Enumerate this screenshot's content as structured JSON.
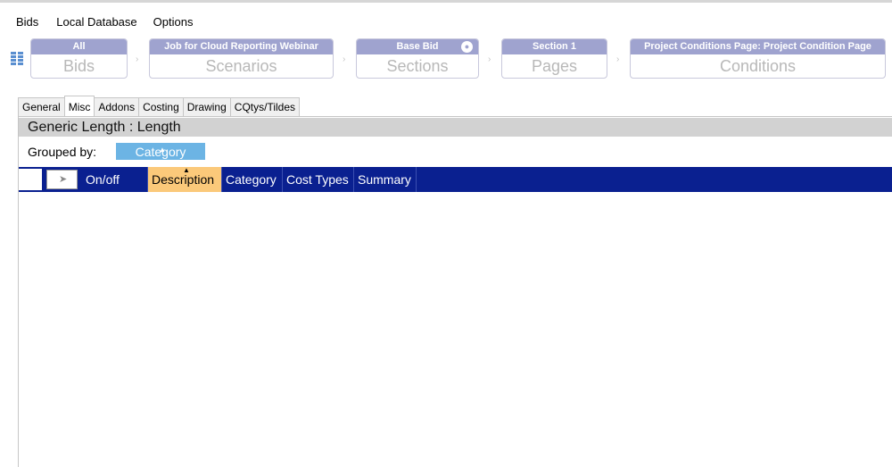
{
  "menu": [
    "Bids",
    "Local Database",
    "Options"
  ],
  "breadcrumb": [
    {
      "head": "All",
      "sub": "Bids"
    },
    {
      "head": "Job for Cloud Reporting Webinar",
      "sub": "Scenarios"
    },
    {
      "head": "Base Bid",
      "sub": "Sections"
    },
    {
      "head": "Section 1",
      "sub": "Pages"
    },
    {
      "head": "Project Conditions Page: Project Condition Page",
      "sub": "Conditions"
    }
  ],
  "breadcrumb_separator": "›",
  "tabs": [
    "General",
    "Misc",
    "Addons",
    "Costing",
    "Drawing",
    "CQtys/Tildes"
  ],
  "active_tab": "Misc",
  "panel": {
    "title": "Generic Length : Length",
    "grouped_label": "Grouped by:",
    "grouped_value": "Category"
  },
  "grid": {
    "columns": [
      "On/off",
      "Description",
      "Category",
      "Cost Types",
      "Summary"
    ],
    "sorted_column": "Description",
    "rows": []
  },
  "colors": {
    "header_bg": "#0a2090",
    "sorted_col_bg": "#fbc97a",
    "group_chip_bg": "#6cb4e4",
    "breadcrumb_head_bg": "#9fa3cf"
  }
}
